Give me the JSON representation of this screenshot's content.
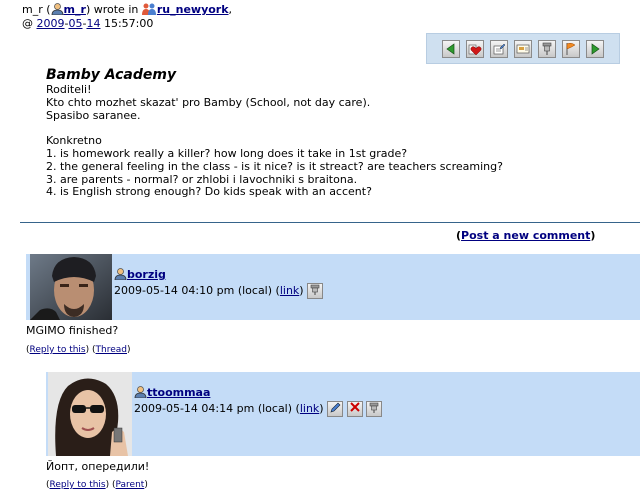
{
  "post": {
    "author": "m_r",
    "wrote_in": "wrote in",
    "community": "ru_newyork",
    "at_symbol": "@",
    "date_year": "2009",
    "date_month": "05",
    "date_day": "14",
    "time": "15:57:00",
    "title": "Bamby Academy",
    "lines": [
      "Roditeli!",
      "Kto chto mozhet skazat' pro Bamby (School, not day care).",
      "Spasibo saranee.",
      "",
      "Konkretno",
      "1. is homework really a killer? how long does it take in 1st grade?",
      "2. the general feeling in the class - is it nice? is it streact? are teachers screaming?",
      "3. are parents - normal? or zhlobi i lavochniki s braitona.",
      "4. is English strong enough? Do kids speak with an accent?"
    ]
  },
  "toolbar": {
    "icons": [
      "prev-arrow-icon",
      "memories-heart-icon",
      "edit-tags-icon",
      "tell-a-friend-icon",
      "track-icon",
      "flag-icon",
      "next-arrow-icon"
    ]
  },
  "actions": {
    "post_new_comment": "Post a new comment"
  },
  "comments": [
    {
      "username": "borzig",
      "timestamp": "2009-05-14 04:10 pm (local)",
      "link_label": "link",
      "text": "MGIMO finished?",
      "reply_label": "Reply to this",
      "second_label": "Thread"
    },
    {
      "username": "ttoommaa",
      "timestamp": "2009-05-14 04:14 pm (local)",
      "link_label": "link",
      "text": "Йопт, опередили!",
      "reply_label": "Reply to this",
      "second_label": "Parent"
    }
  ],
  "colors": {
    "comment_bg": "#c4dcf7",
    "toolbar_bg": "#cfe0f0",
    "link": "#000080",
    "divider": "#36648b"
  }
}
